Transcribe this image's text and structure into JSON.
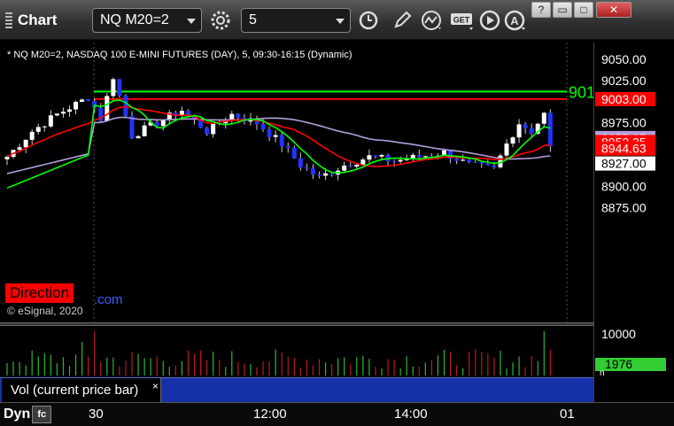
{
  "app": {
    "title": "Chart"
  },
  "toolbar": {
    "symbol": "NQ M20=2",
    "interval": "5",
    "buttons": [
      "settings-icon",
      "clock-icon",
      "pencil-icon",
      "studies-icon",
      "get-icon",
      "play-icon",
      "alert-icon"
    ],
    "get_label": "GET",
    "alert_label": "A"
  },
  "window_buttons": {
    "help": "?",
    "restore": "▭",
    "maximize": "□",
    "close": "✕"
  },
  "chart": {
    "caption": "* NQ M20=2, NASDAQ 100 E-MINI FUTURES (DAY), 5, 09:30-16:15 (Dynamic)",
    "direction_label": "Direction",
    "direction_link": ".com",
    "copyright": "© eSignal, 2020",
    "green_line_label": "901",
    "price_ticks": [
      "9050.00",
      "9025.00",
      "9003.00",
      "8975.00",
      "8957.07",
      "8952.35",
      "8944.63",
      "8927.00",
      "8900.00",
      "8875.00"
    ],
    "volume_ticks": [
      "10000",
      "1976",
      "n"
    ],
    "volume_label": "Vol (current price bar)",
    "volume_close": "×",
    "time_ticks": [
      "30",
      "12:00",
      "14:00",
      "01"
    ],
    "dyn_label": "Dyn",
    "dyn_icon": "fc"
  },
  "chart_data": {
    "type": "candlestick",
    "symbol": "NQ M20=2",
    "yaxis_ticks": [
      8875,
      8900,
      8925,
      8950,
      8975,
      9000,
      9025,
      9050
    ],
    "markers": [
      {
        "label": "9003.00",
        "value": 9003.0,
        "color": "#ff0000"
      },
      {
        "label": "8957.07",
        "value": 8957.07,
        "color": "#b39ddb"
      },
      {
        "label": "8952.35",
        "value": 8952.35,
        "color": "#ff0000"
      },
      {
        "label": "8944.63",
        "value": 8944.63,
        "color": "#ff0000"
      },
      {
        "label": "8927.00",
        "value": 8927.0,
        "color": "#ffffff"
      }
    ],
    "horizontal_lines": [
      {
        "value": 9012,
        "color": "#00ff00"
      },
      {
        "value": 9003,
        "color": "#ff0000"
      }
    ],
    "volume_markers": [
      {
        "label": "1976",
        "value": 1976,
        "color": "#33cc33"
      }
    ],
    "colors": {
      "up": "#ffffff",
      "down": "#2233ff",
      "ma_fast": "#00ff00",
      "ma_mid": "#ff0000",
      "ma_slow": "#b39ddb",
      "vol_up": "#2db82d",
      "vol_down": "#c01a1a"
    }
  }
}
